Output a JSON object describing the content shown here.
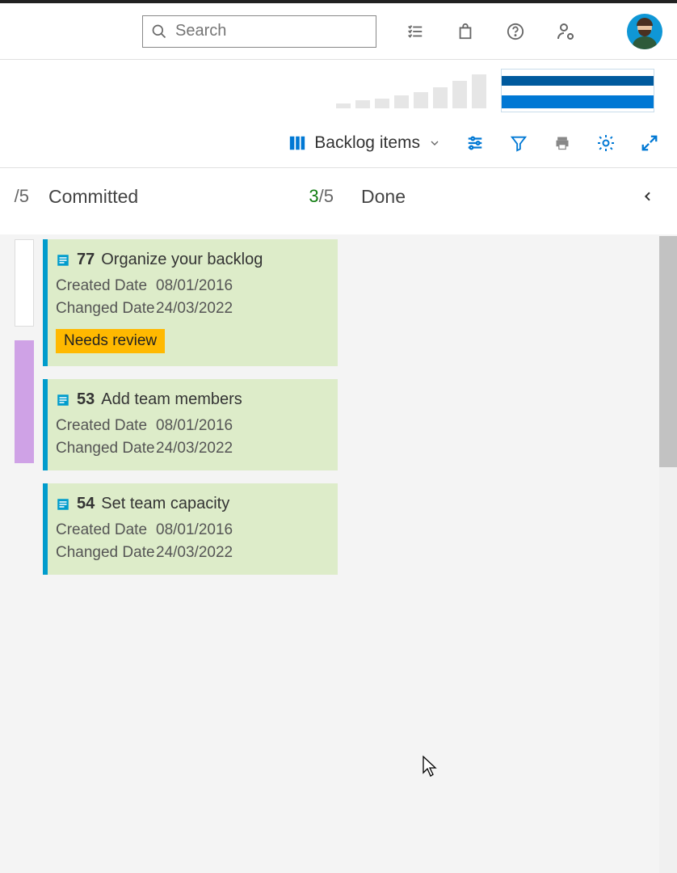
{
  "header": {
    "search_placeholder": "Search"
  },
  "toolbar": {
    "view_label": "Backlog items"
  },
  "columns": {
    "left_partial_wip": "/5",
    "committed": {
      "title": "Committed",
      "count": "3",
      "wip": "/5"
    },
    "done": {
      "title": "Done"
    }
  },
  "fields": {
    "created_label": "Created Date",
    "changed_label": "Changed Date"
  },
  "cards": [
    {
      "id": "77",
      "title": "Organize your backlog",
      "created": "08/01/2016",
      "changed": "24/03/2022",
      "tag": "Needs review"
    },
    {
      "id": "53",
      "title": "Add team members",
      "created": "08/01/2016",
      "changed": "24/03/2022"
    },
    {
      "id": "54",
      "title": "Set team capacity",
      "created": "08/01/2016",
      "changed": "24/03/2022"
    }
  ],
  "chart_data": {
    "type": "bar",
    "note": "Mini bar sparkline with no axis labels; heights approximate only",
    "bars": [
      6,
      10,
      12,
      16,
      20,
      26,
      34,
      42
    ]
  }
}
